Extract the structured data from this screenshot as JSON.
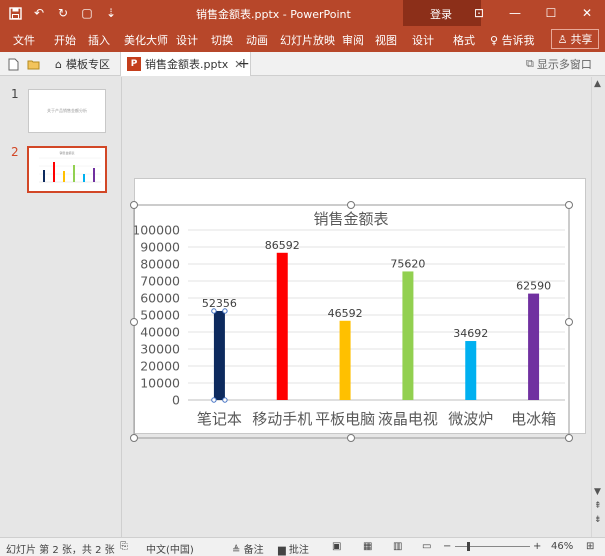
{
  "titlebar": {
    "title": "销售金额表.pptx  -  PowerPoint",
    "login": "登录",
    "qat_icons": [
      "save-icon",
      "undo-icon",
      "redo-icon",
      "present-icon",
      "customize-icon"
    ]
  },
  "ribbon": {
    "tabs": [
      "文件",
      "开始",
      "插入",
      "美化大师",
      "设计",
      "切换",
      "动画",
      "幻灯片放映",
      "审阅",
      "视图"
    ],
    "context_tabs": [
      "设计",
      "格式"
    ],
    "tell_me": "告诉我",
    "share": "共享"
  },
  "tabbar": {
    "template_tab": "模板专区",
    "doc_tab": "销售金额表.pptx",
    "multi_window": "显示多窗口"
  },
  "thumbnails": [
    {
      "number": "1",
      "text": "关于产品销售金额分析"
    },
    {
      "number": "2",
      "text": ""
    }
  ],
  "status": {
    "slide_info": "幻灯片 第 2 张，共 2 张",
    "language": "中文(中国)",
    "notes": "备注",
    "comments": "批注",
    "zoom": "46%"
  },
  "colors": {
    "brand": "#b7472a",
    "selection": "#d24726"
  },
  "chart_data": {
    "type": "bar",
    "title": "销售金额表",
    "categories": [
      "笔记本",
      "移动手机",
      "平板电脑",
      "液晶电视",
      "微波炉",
      "电冰箱"
    ],
    "values": [
      52356,
      86592,
      46592,
      75620,
      34692,
      62590
    ],
    "colors": [
      "#0d2a5e",
      "#ff0000",
      "#ffc000",
      "#92d050",
      "#00b0f0",
      "#7030a0"
    ],
    "ylim": [
      0,
      100000
    ],
    "yticks": [
      "0",
      "10000",
      "20000",
      "30000",
      "40000",
      "50000",
      "60000",
      "70000",
      "80000",
      "90000",
      "100000"
    ],
    "grid": true,
    "data_labels": true
  }
}
